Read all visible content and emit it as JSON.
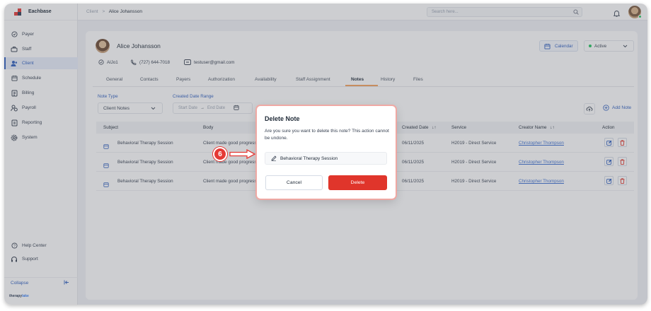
{
  "app": {
    "name": "Eachbase",
    "powered_prefix": "therapy",
    "powered_suffix": "lake"
  },
  "colors": {
    "accent": "#2f5fbf",
    "danger": "#e0352b",
    "active_tab_underline": "#f5a35c",
    "status_active": "#22c55e"
  },
  "sidebar": {
    "items": [
      {
        "label": "Payer",
        "icon": "shield-icon"
      },
      {
        "label": "Staff",
        "icon": "staff-icon"
      },
      {
        "label": "Client",
        "icon": "client-icon",
        "active": true
      },
      {
        "label": "Schedule",
        "icon": "calendar-icon"
      },
      {
        "label": "Billing",
        "icon": "billing-icon"
      },
      {
        "label": "Payroll",
        "icon": "payroll-icon"
      },
      {
        "label": "Reporting",
        "icon": "report-icon"
      },
      {
        "label": "System",
        "icon": "gear-icon"
      }
    ],
    "help_label": "Help Center",
    "support_label": "Support",
    "collapse_label": "Collapse"
  },
  "topbar": {
    "breadcrumb_root": "Client",
    "breadcrumb_sep": ">",
    "breadcrumb_current": "Alice Johansson",
    "search_placeholder": "Search here..."
  },
  "profile": {
    "name": "Alice Johansson",
    "id": "AlJo1",
    "phone": "(727) 644-7018",
    "email": "testuser@gmail.com",
    "calendar_label": "Calendar",
    "status_label": "Active"
  },
  "tabs": [
    {
      "label": "General"
    },
    {
      "label": "Contacts"
    },
    {
      "label": "Payers"
    },
    {
      "label": "Authorization"
    },
    {
      "label": "Availability"
    },
    {
      "label": "Staff Assignment"
    },
    {
      "label": "Notes",
      "active": true
    },
    {
      "label": "History"
    },
    {
      "label": "Files"
    }
  ],
  "filters": {
    "note_type_label": "Note Type",
    "note_type_value": "Client Notes",
    "date_range_label": "Created Date Range",
    "start_placeholder": "Start Date",
    "end_placeholder": "End Date",
    "add_note_label": "Add Note"
  },
  "table": {
    "columns": [
      "Subject",
      "Body",
      "Created Date",
      "Service",
      "Creator Name",
      "Action"
    ],
    "rows": [
      {
        "subject": "Behavioral Therapy Session",
        "body": "Client made good progress",
        "created": "06/11/2025",
        "service": "H2019 - Direct Service",
        "creator": "Christopher Thompson"
      },
      {
        "subject": "Behavioral Therapy Session",
        "body": "Client made good progress",
        "created": "06/11/2025",
        "service": "H2019 - Direct Service",
        "creator": "Christopher Thompson"
      },
      {
        "subject": "Behavioral Therapy Session",
        "body": "Client made good progress",
        "created": "06/11/2025",
        "service": "H2019 - Direct Service",
        "creator": "Christopher Thompson"
      }
    ]
  },
  "modal": {
    "title": "Delete Note",
    "message": "Are you sure you want to delete this note? This action cannot be undone.",
    "note_name": "Behavioral Therapy Session",
    "cancel_label": "Cancel",
    "delete_label": "Delete"
  },
  "step_badge": "6"
}
